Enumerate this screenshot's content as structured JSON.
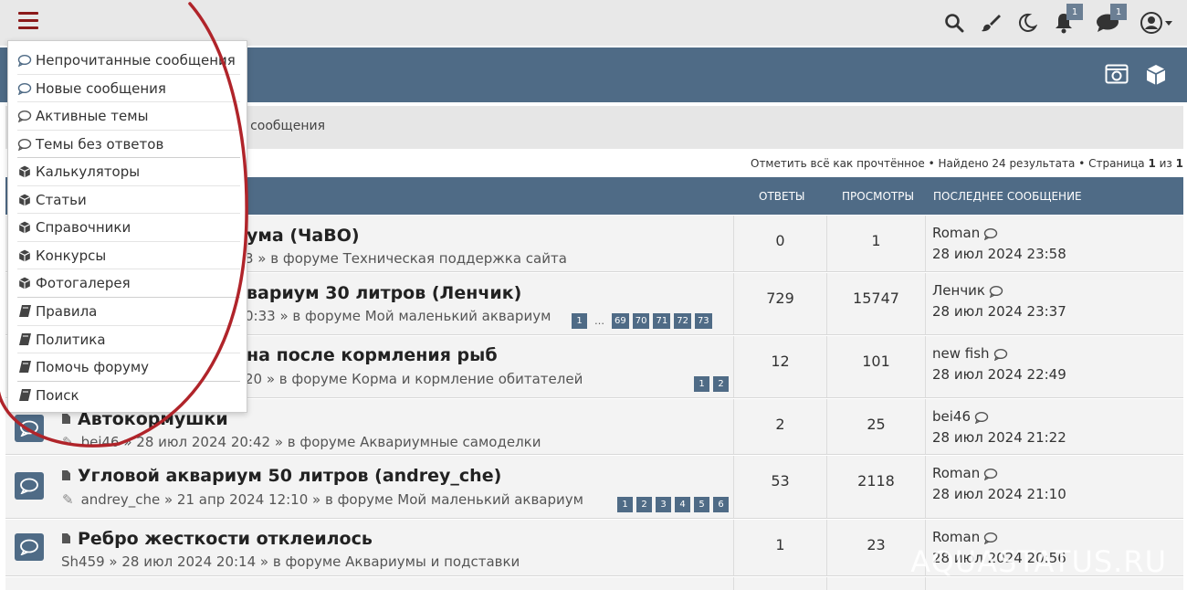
{
  "topbar": {
    "menu_icon": "hamburger-icon",
    "icons": [
      "search-icon",
      "brush-icon",
      "moon-icon",
      "bell-icon",
      "chat-icon",
      "user-icon"
    ],
    "notifications_count": "1",
    "messages_count": "1",
    "accent": "#8b1a1a"
  },
  "navbar": {
    "icons": [
      "camera-icon",
      "cube-icon"
    ],
    "color": "#4f6b86"
  },
  "crumb": {
    "text": "е сообщения"
  },
  "actions": {
    "mark_read": "Отметить всё как прочтённое",
    "found": "Найдено 24 результата",
    "page_label": "Страница",
    "page_current": "1",
    "page_of": "из",
    "page_total": "1",
    "sep": "•"
  },
  "thead": {
    "answers": "ОТВЕТЫ",
    "views": "ПРОСМОТРЫ",
    "last": "ПОСЛЕДНЕЕ СООБЩЕНИЕ"
  },
  "rows": [
    {
      "title": "ума (ЧаВО)",
      "meta": "3 » в форуме Техническая поддержка сайта",
      "answers": "0",
      "views": "1",
      "last_user": "Roman",
      "last_date": "28 июл 2024 23:58",
      "pages": []
    },
    {
      "title": "вариум 30 литров (Ленчик)",
      "meta": "0:33 » в форуме Мой маленький аквариум",
      "answers": "729",
      "views": "15747",
      "last_user": "Ленчик",
      "last_date": "28 июл 2024 23:37",
      "pages": [
        "1",
        "…",
        "69",
        "70",
        "71",
        "72",
        "73"
      ]
    },
    {
      "title": "на после кормления рыб",
      "meta": "20 » в форуме Корма и кормление обитателей",
      "answers": "12",
      "views": "101",
      "last_user": "new fish",
      "last_date": "28 июл 2024 22:49",
      "pages": [
        "1",
        "2"
      ]
    },
    {
      "title": "Автокормушки",
      "meta": "bei46 » 28 июл 2024 20:42 » в форуме Аквариумные самоделки",
      "answers": "2",
      "views": "25",
      "last_user": "bei46",
      "last_date": "28 июл 2024 21:22",
      "pages": []
    },
    {
      "title": "Угловой аквариум 50 литров (andrey_che)",
      "meta": "andrey_che » 21 апр 2024 12:10 » в форуме Мой маленький аквариум",
      "answers": "53",
      "views": "2118",
      "last_user": "Roman",
      "last_date": "28 июл 2024 21:10",
      "pages": [
        "1",
        "2",
        "3",
        "4",
        "5",
        "6"
      ]
    },
    {
      "title": "Ребро жесткости отклеилось",
      "meta": "Sh459 » 28 июл 2024 20:14 » в форуме Аквариумы и подставки",
      "answers": "1",
      "views": "23",
      "last_user": "Roman",
      "last_date": "28 июл 2024 20:56",
      "pages": []
    }
  ],
  "dropdown": {
    "items": [
      {
        "label": "Непрочитанные сообщения",
        "icon": "speech-bubble-icon"
      },
      {
        "label": "Новые сообщения",
        "icon": "speech-bubble-icon"
      },
      {
        "label": "Активные темы",
        "icon": "speech-bubble-icon"
      },
      {
        "label": "Темы без ответов",
        "icon": "speech-bubble-icon"
      },
      {
        "label": "Калькуляторы",
        "icon": "cube-icon"
      },
      {
        "label": "Статьи",
        "icon": "cube-icon"
      },
      {
        "label": "Справочники",
        "icon": "cube-icon"
      },
      {
        "label": "Конкурсы",
        "icon": "cube-icon"
      },
      {
        "label": "Фотогалерея",
        "icon": "cube-icon"
      },
      {
        "label": "Правила",
        "icon": "book-icon"
      },
      {
        "label": "Политика",
        "icon": "book-icon"
      },
      {
        "label": "Помочь форуму",
        "icon": "book-icon"
      },
      {
        "label": "Поиск",
        "icon": "book-icon"
      }
    ]
  },
  "watermark": "AQUASTATUS.RU",
  "annotation_color": "#b0242a"
}
